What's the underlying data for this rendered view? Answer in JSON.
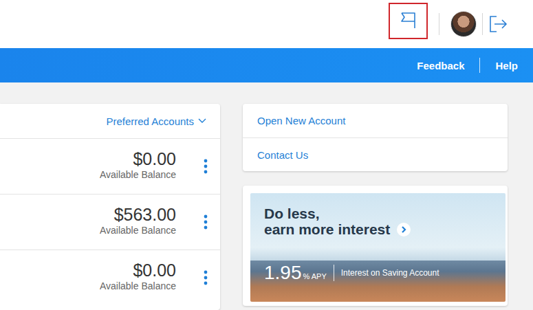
{
  "header": {
    "flag": {
      "highlighted": true
    }
  },
  "nav": {
    "links": [
      "Feedback",
      "Help"
    ]
  },
  "accounts": {
    "filter": "Preferred Accounts",
    "rows": [
      {
        "balance": "$0.00",
        "label": "Available Balance"
      },
      {
        "balance": "$563.00",
        "label": "Available Balance"
      },
      {
        "balance": "$0.00",
        "label": "Available Balance"
      }
    ]
  },
  "quick_links": [
    "Open New Account",
    "Contact Us"
  ],
  "promo": {
    "headline": [
      "Do less,",
      "earn more interest"
    ],
    "rate": "1.95",
    "unit": "% APY",
    "caption": "Interest on Saving Account"
  }
}
